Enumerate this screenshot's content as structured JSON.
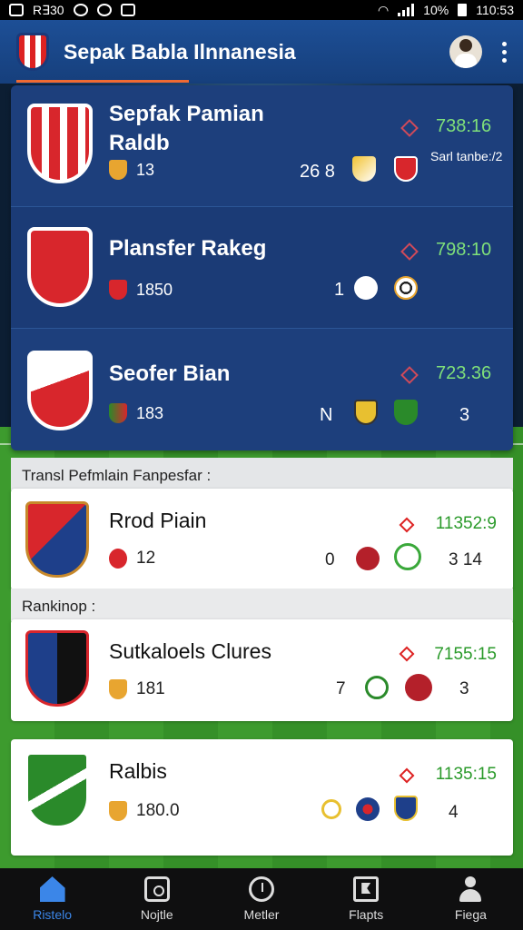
{
  "status_bar": {
    "left_text": "R∃30",
    "battery_text": "10%",
    "time": "110:53"
  },
  "app_bar": {
    "title": "Sepak Babla Ilnnanesia"
  },
  "featured": [
    {
      "title_line1": "Sepfak Pamian",
      "title_line2": "Raldb",
      "time": "738:16",
      "subtitle": "Sarl tanbe:/2",
      "meta_value": "13",
      "score": "26 8",
      "crest_color": "#d8262c"
    },
    {
      "title_line1": "Plansfer Rakeg",
      "title_line2": "",
      "time": "798:10",
      "subtitle": "",
      "meta_value": "1850",
      "score": "1",
      "crest_color": "#d8262c"
    },
    {
      "title_line1": "Seofer Bian",
      "title_line2": "",
      "time": "723.36",
      "subtitle": "",
      "meta_value": "183",
      "score": "Ν",
      "extra": "3",
      "crest_color": "#d8262c"
    }
  ],
  "sections": {
    "transfers": "Transl Pefmlain Fanpesfar :",
    "rankings": "Rankinop :"
  },
  "list": [
    {
      "title": "Rrod Piain",
      "time": "11352:9",
      "meta_value": "12",
      "score_left": "0",
      "score_right": "3 14"
    },
    {
      "title": "Sutkaloels Clures",
      "time": "7155:15",
      "meta_value": "181",
      "score_left": "7",
      "score_right": "3"
    },
    {
      "title": "Ralbis",
      "time": "1135:15",
      "meta_value": "180.0",
      "score_left": "",
      "score_right": "4"
    }
  ],
  "bottom_nav": [
    {
      "label": "Ristelo",
      "icon": "home-icon"
    },
    {
      "label": "Nojtle",
      "icon": "camera-icon"
    },
    {
      "label": "Metler",
      "icon": "clock-icon"
    },
    {
      "label": "Flapts",
      "icon": "flag-icon"
    },
    {
      "label": "Fiega",
      "icon": "person-icon"
    }
  ],
  "colors": {
    "app_bar": "#1d4f96",
    "accent_time": "#7fe07a",
    "list_time": "#2a9a2a",
    "nav_active": "#3b86e8"
  }
}
